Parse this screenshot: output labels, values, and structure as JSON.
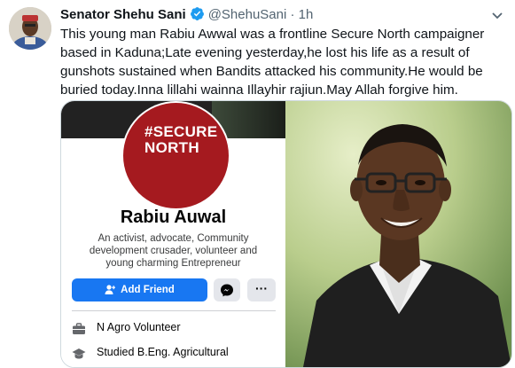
{
  "tweet": {
    "name": "Senator Shehu Sani",
    "handle": "@ShehuSani",
    "separator": "·",
    "time": "1h",
    "text": "This young man Rabiu Awwal was a frontline Secure North campaigner based in Kaduna;Late evening yesterday,he lost his life as a result of gunshots sustained when Bandits attacked his community.He would be buried today.Inna lillahi wainna Illayhir rajiun.May Allah forgive him."
  },
  "profile_card": {
    "logo_line1": "#SECURE",
    "logo_line2": "NORTH",
    "name": "Rabiu Auwal",
    "bio": "An activist, advocate, Community development crusader, volunteer and young charming Entrepreneur",
    "add_friend_label": "Add Friend",
    "more_label": "···",
    "info": [
      {
        "icon": "briefcase-icon",
        "text": "N Agro Volunteer"
      },
      {
        "icon": "graduation-cap-icon",
        "text": "Studied B.Eng. Agricultural"
      }
    ]
  },
  "colors": {
    "verified": "#1d9bf0",
    "logo_red": "#a51a1f",
    "fb_blue": "#1877f2"
  }
}
